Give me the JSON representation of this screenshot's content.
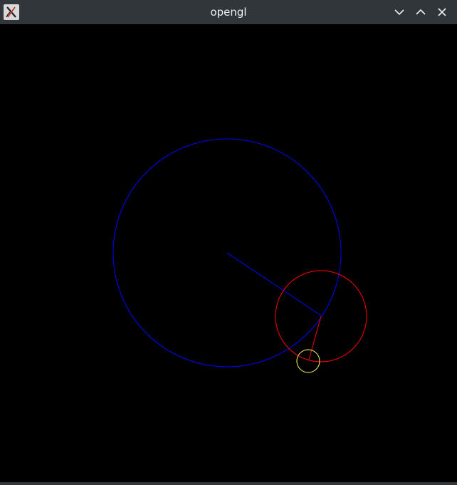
{
  "window": {
    "title": "opengl",
    "app_icon": "x-window-system-icon",
    "controls": [
      "minimize-icon",
      "maximize-icon",
      "close-icon"
    ]
  },
  "scene": {
    "background_color": "#000000",
    "big_circle_color": "#0000ff",
    "big_arm_color": "#0000ff",
    "mid_circle_color": "#ff0000",
    "mid_arm_color": "#ff0000",
    "small_circle_color": "#ffff66"
  }
}
